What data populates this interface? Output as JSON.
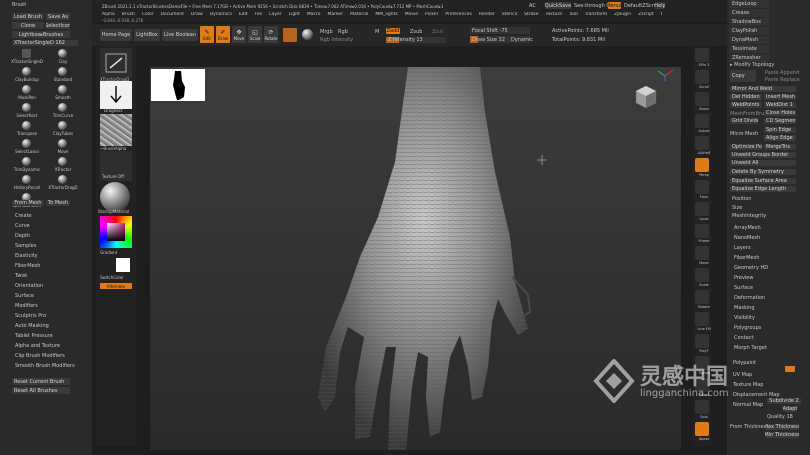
{
  "brush_palette": {
    "title": "Brush",
    "top_buttons": [
      "Load Brush",
      "Save As",
      "Clone",
      "SelectIcon",
      "Lightbox▸Brushes"
    ],
    "current_brush": "XTractorSingleD",
    "current_size": "162",
    "tools": [
      {
        "name": "XTractorSingleD",
        "icon": "xtractor-icon"
      },
      {
        "name": "Clay",
        "icon": "clay-icon"
      },
      {
        "name": "ClayBuildup",
        "icon": "claybuildup-icon"
      },
      {
        "name": "Standard",
        "icon": "standard-icon"
      },
      {
        "name": "MaskPen",
        "icon": "maskpen-icon"
      },
      {
        "name": "Smooth",
        "icon": "smooth-icon"
      },
      {
        "name": "SelectRect",
        "icon": "selectrect-icon"
      },
      {
        "name": "TrimCurve",
        "icon": "trimcurve-icon"
      },
      {
        "name": "Transpose",
        "icon": "transpose-icon"
      },
      {
        "name": "ClayTubes",
        "icon": "claytubes-icon"
      },
      {
        "name": "SelectLasso",
        "icon": "selectlasso-icon"
      },
      {
        "name": "Move",
        "icon": "move-icon"
      },
      {
        "name": "TrimDynamic",
        "icon": "trimdynamic-icon"
      },
      {
        "name": "XTractor",
        "icon": "xtractor2-icon"
      },
      {
        "name": "HistoryRecall",
        "icon": "history-icon"
      },
      {
        "name": "XTractorDragD",
        "icon": "xtractordrag-icon"
      },
      {
        "name": "DamStandard",
        "icon": "damstandard-icon"
      }
    ],
    "from_mesh": "From Mesh",
    "to_mesh": "To Mesh",
    "sections": [
      "Create",
      "Curve",
      "Depth",
      "Samples",
      "Elasticity",
      "FiberMesh",
      "Twist",
      "Orientation",
      "Surface",
      "Modifiers",
      "Sculptris Pro",
      "Auto Masking",
      "Tablet Pressure",
      "Alpha and Texture",
      "Clip Brush Modifiers",
      "Smooth Brush Modifiers"
    ],
    "reset_current": "Reset Current Brush",
    "reset_all": "Reset All Brushes"
  },
  "top_bar": {
    "title": "ZBrush 2021.1.1  xTractorBrushesDemoFile  • Free Mem 7.17GB • Active Mem 9256 • Scratch Disk 6839 • Timer▸7.062 ATime▸0.016 • PolyCount▸7.712 MP • MeshCount▸3",
    "ac": "AC",
    "quicksave": "QuickSave",
    "see_through": "See-through  0",
    "menus_label": "Menus",
    "default_script": "DefaultZScript",
    "help": "Help",
    "menu": [
      "Alpha",
      "Brush",
      "Color",
      "Document",
      "Draw",
      "Dynamics",
      "Edit",
      "File",
      "Layer",
      "Light",
      "Macro",
      "Marker",
      "Material",
      "MM_lights",
      "Movie",
      "Picker",
      "Preferences",
      "Render",
      "Stencil",
      "Stroke",
      "Texture",
      "Tool",
      "Transform",
      "Zplugin",
      "Zscript",
      "Help"
    ],
    "coords": "-0.846,-0.938,-0.276"
  },
  "shelf": {
    "home_page": "Home Page",
    "lightbox": "LightBox",
    "live_boolean": "Live Boolean",
    "edit": "Edit",
    "draw": "Draw",
    "move": "Move",
    "scale": "Scale",
    "rotate": "Rotate",
    "mrgb": "Mrgb",
    "rgb": "Rgb",
    "m": "M",
    "zadd": "Zadd",
    "zsub": "Zsub",
    "zcut": "Zcut",
    "focal_shift_label": "Focal Shift",
    "focal_shift_value": "-75",
    "draw_size_label": "Draw Size",
    "draw_size_value": "32",
    "dynamic": "Dynamic",
    "z_intensity_label": "Z Intensity",
    "z_intensity_value": "13",
    "active_points": "ActivePoints: 7.685 Mil",
    "total_points": "TotalPoints: 9.831 Mil",
    "rgb_intensity": "Rgb Intensity"
  },
  "left_strip": {
    "brush_name": "XTractorDragD",
    "stroke_name": "DragRect",
    "alpha_name": "~BrushAlpha",
    "texture_name": "Texture Off",
    "material_name": "StartupMaterial",
    "gradient": "Gradient",
    "switch_color": "SwitchColor",
    "alternate": "Alternate"
  },
  "right_tools": {
    "labels": [
      "SPix 3",
      "Scroll",
      "Zoom",
      "Actual",
      "AAHalf",
      "Persp",
      "Floor",
      "Local",
      "Frame",
      "Move",
      "Scale",
      "Rotate",
      "Line Fill",
      "PolyF",
      "Transp",
      "Ghost",
      "Solo",
      "Xpose"
    ]
  },
  "tool_palette": {
    "top_items": [
      "EdgeLoop",
      "Crease",
      "ShadowBox",
      "ClayPolish",
      "DynaMesh",
      "Tessimate",
      "ZRemesher"
    ],
    "modify_topology": "▸ Modify Topology",
    "copy": "Copy",
    "paste_append": "Paste Append",
    "paste_replace": "Paste Replace",
    "mirror_weld": "Mirror And Weld",
    "del_hidden": "Del Hidden",
    "insert_mesh": "Insert Mesh",
    "weldpoints": "WeldPoints",
    "weld_dist": "WeldDist 1",
    "mesh_from_brush": "MeshFromBrush",
    "close_holes": "Close Holes",
    "grid_divide": "Grid Divide",
    "cd_segments": "CD Segments",
    "micro_mesh": "Micro Mesh",
    "spin_edge": "Spin Edge",
    "align_edge": "Align Edge",
    "optimize_points": "Optimize Points",
    "merge_tris": "MergeTris",
    "unweld_groups_border": "Unweld Groups Border",
    "unweld_all": "Unweld All",
    "delete_by_symmetry": "Delete By Symmetry",
    "equalize_surface_area": "Equalize Surface Area",
    "equalize_edge_length": "Equalize Edge Length",
    "position": "Position",
    "size": "Size",
    "mesh_integrity": "MeshIntegrity",
    "sections": [
      "ArrayMesh",
      "NanoMesh",
      "Layers",
      "FiberMesh",
      "Geometry HD",
      "Preview",
      "Surface",
      "Deformation",
      "Masking",
      "Visibility",
      "Polygroups",
      "Contact",
      "Morph Target"
    ],
    "polypaint": "Polypaint",
    "uv_map": "UV Map",
    "texture_map": "Texture Map",
    "displacement": "Displacement Map",
    "normal_map": "Normal Map",
    "from_thickness": "From Thickness",
    "max_thickness": "Max Thickness",
    "min_thickness": "Min Thickness",
    "subdiv": "Subdivide 2",
    "quality": "Quality 18",
    "adaptive": "Adapt"
  },
  "watermark": {
    "cn": "灵感中国",
    "url": "lingganchina.com"
  },
  "colors": {
    "accent": "#e07b1a",
    "panel": "#2a2a2a",
    "canvas": "#3b3b3b"
  }
}
